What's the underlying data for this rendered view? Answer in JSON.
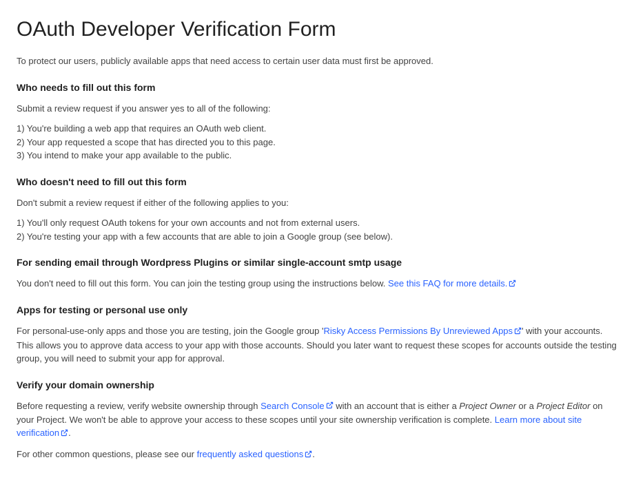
{
  "title": "OAuth Developer Verification Form",
  "intro": "To protect our users, publicly available apps that need access to certain user data must first be approved.",
  "section1": {
    "heading": "Who needs to fill out this form",
    "lead": "Submit a review request if you answer yes to all of the following:",
    "items": [
      "1) You're building a web app that requires an OAuth web client.",
      "2) Your app requested a scope that has directed you to this page.",
      "3) You intend to make your app available to the public."
    ]
  },
  "section2": {
    "heading": "Who doesn't need to fill out this form",
    "lead": "Don't submit a review request if either of the following applies to you:",
    "items": [
      "1) You'll only request OAuth tokens for your own accounts and not from external users.",
      "2) You're testing your app with a few accounts that are able to join a Google group (see below)."
    ]
  },
  "section3": {
    "heading": "For sending email through Wordpress Plugins or similar single-account smtp usage",
    "text_before_link": "You don't need to fill out this form. You can join the testing group using the instructions below. ",
    "link": "See this FAQ for more details."
  },
  "section4": {
    "heading": "Apps for testing or personal use only",
    "text_before": "For personal-use-only apps and those you are testing, join the Google group '",
    "link": "Risky Access Permissions By Unreviewed Apps",
    "text_after": "' with your accounts. This allows you to approve data access to your app with those accounts. Should you later want to request these scopes for accounts outside the testing group, you will need to submit your app for approval."
  },
  "section5": {
    "heading": "Verify your domain ownership",
    "p1_before": "Before requesting a review, verify website ownership through ",
    "p1_link1": "Search Console",
    "p1_mid1": " with an account that is either a ",
    "p1_em1": "Project Owner",
    "p1_mid2": " or a ",
    "p1_em2": "Project Editor",
    "p1_mid3": " on your Project. We won't be able to approve your access to these scopes until your site ownership verification is complete. ",
    "p1_link2": "Learn more about site verification",
    "p1_after": ".",
    "p2_before": "For other common questions, please see our ",
    "p2_link": "frequently asked questions",
    "p2_after": "."
  }
}
